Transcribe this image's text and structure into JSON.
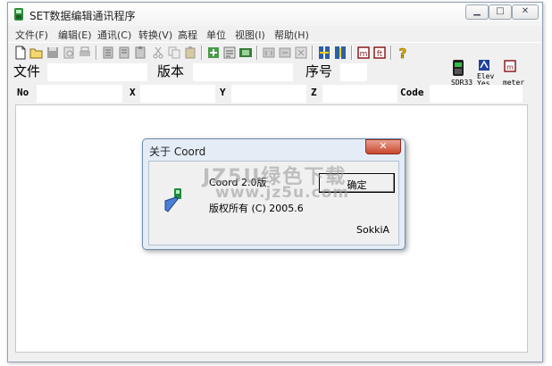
{
  "window": {
    "title": "SET数据编辑通讯程序"
  },
  "menu": [
    "文件(F)",
    "编辑(E)",
    "通讯(C)",
    "转换(V)",
    "高程",
    "单位",
    "视图(I)",
    "帮助(H)"
  ],
  "header_fields": {
    "file_label": "文件",
    "version_label": "版本",
    "serial_label": "序号"
  },
  "columns": {
    "no": "No",
    "x": "X",
    "y": "Y",
    "z": "Z",
    "code": "Code"
  },
  "status_indicators": {
    "sdr": "SDR33",
    "elev_line1": "Elev",
    "elev_line2": "Yes",
    "unit": "meter"
  },
  "dialog": {
    "title": "关于 Coord",
    "version_text": "Coord 2.0版",
    "copyright_text": "版权所有 (C) 2005.6",
    "company": "SokkiA",
    "ok_label": "确定"
  },
  "watermark": {
    "line1": "JZ5U绿色下载",
    "line2": "www.jz5u.com"
  },
  "icons": {
    "toolbar": [
      "new-file-icon",
      "open-folder-icon",
      "save-icon",
      "print-preview-icon",
      "print-icon",
      "cut-icon",
      "copy-icon",
      "paste-icon",
      "cut-icon",
      "copy-icon",
      "paste-icon",
      "receive-data-icon",
      "send-data-icon",
      "convert-icon",
      "import-icon",
      "export-icon",
      "report-icon",
      "transfer-up-icon",
      "transfer-down-icon",
      "meter-unit-icon",
      "feet-unit-icon",
      "help-icon"
    ]
  }
}
